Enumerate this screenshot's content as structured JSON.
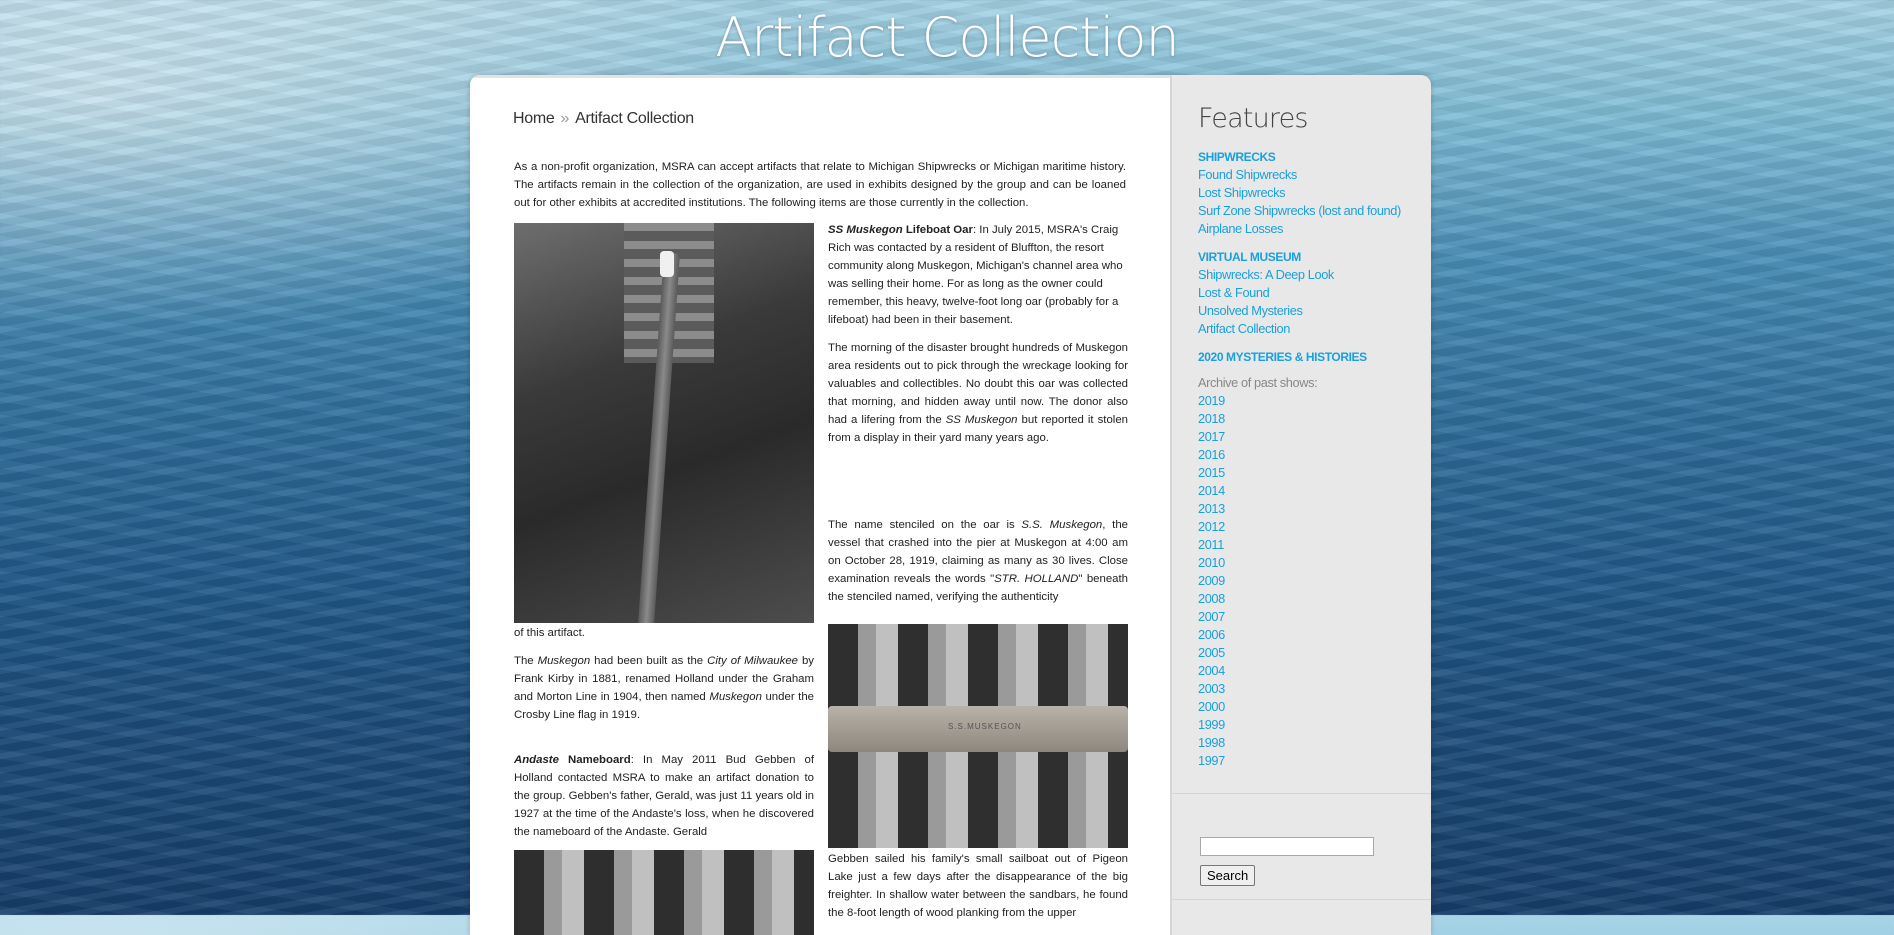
{
  "site": {
    "title": "Artifact Collection"
  },
  "breadcrumb": {
    "home": "Home",
    "separator": "»",
    "current": "Artifact Collection"
  },
  "content": {
    "intro": "As a non-profit organization, MSRA can accept artifacts that relate to Michigan Shipwrecks or Michigan maritime history. The artifacts remain in the collection of the organization, are used in exhibits designed by the group and can be loaned out for other exhibits at accredited institutions. The following items are those currently in the collection.",
    "oar": {
      "title_italic": "SS Muskegon",
      "title_rest": " Lifeboat Oar",
      "p1": ": In July 2015, MSRA's Craig Rich was contacted by a resident of Bluffton, the resort community along Muskegon, Michigan's  channel area who was selling their home. For as long as the owner could remember, this heavy, twelve-foot long oar (probably for a lifeboat) had been in their basement.",
      "p2a": "The morning of the disaster brought hundreds of Muskegon area residents out to pick through the wreckage looking for valuables and collectibles. No doubt this oar was collected that morning, and hidden away until now. The donor also had a lifering from the ",
      "p2_italic": "SS Muskegon",
      "p2b": " but reported it stolen from a display in their yard many years ago.",
      "p3a": "The name stenciled on the oar is ",
      "p3_italic": "S.S. Muskegon",
      "p3b": ", the vessel that crashed into the pier at Muskegon at 4:00 am on October 28, 1919, claiming as many as 30 lives. Close examination reveals the words \"",
      "p3_italic2": "STR. HOLLAND",
      "p3c": "\" beneath the stenciled named, verifying the authenticity",
      "p3_end": "of this artifact.",
      "p4a": "The ",
      "p4_i1": "Muskegon",
      "p4b": " had been built as the ",
      "p4_i2": "City of Milwaukee",
      "p4c": " by Frank Kirby in 1881, renamed Holland under the Graham and Morton Line in 1904, then named ",
      "p4_i3": "Muskegon",
      "p4d": " under the Crosby Line flag in 1919."
    },
    "andaste": {
      "title_italic": "Andaste",
      "title_rest": " Nameboard",
      "p1": ": In May 2011 Bud Gebben of Holland contacted MSRA to make an artifact donation to the group. Gebben's father, Gerald, was just 11 years old in 1927 at the time of the Andaste's loss, when he discovered the nameboard of the Andaste. Gerald",
      "p2": "Gebben sailed his family's small sailboat out of Pigeon Lake just a few days after the disappearance of the big freighter. In shallow water between the sandbars, he found the 8-foot length of wood planking from the upper"
    },
    "plank_text": "S.S.MUSKEGON"
  },
  "sidebar": {
    "title": "Features",
    "sections": [
      {
        "head": "SHIPWRECKS",
        "links": [
          "Found Shipwrecks",
          "Lost Shipwrecks",
          "Surf Zone Shipwrecks (lost and found)",
          "Airplane Losses"
        ]
      },
      {
        "head": "VIRTUAL MUSEUM",
        "links": [
          "Shipwrecks: A Deep Look",
          "Lost & Found",
          "Unsolved Mysteries",
          "Artifact Collection"
        ]
      },
      {
        "head": "2020 MYSTERIES & HISTORIES",
        "links": []
      }
    ],
    "archive_label": "Archive of past shows:",
    "years": [
      "2019",
      "2018",
      "2017",
      "2016",
      "2015",
      "2014",
      "2013",
      "2012",
      "2011",
      "2010",
      "2009",
      "2008",
      "2007",
      "2006",
      "2005",
      "2004",
      "2003",
      "2000",
      "1999",
      "1998",
      "1997"
    ],
    "search_button": "Search",
    "search_value": ""
  },
  "colors": {
    "link": "#1aa0dd",
    "content_bg": "#ffffff",
    "sidebar_bg": "#e8e8e8"
  }
}
